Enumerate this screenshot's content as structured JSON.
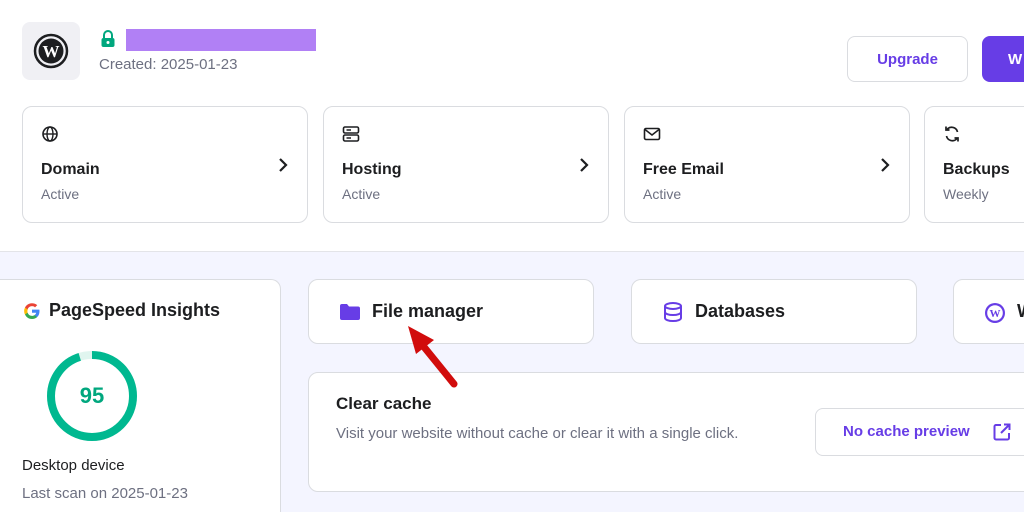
{
  "header": {
    "created": "Created: 2025-01-23",
    "upgrade_label": "Upgrade",
    "primary_label": "W"
  },
  "status_cards": [
    {
      "title": "Domain",
      "status": "Active",
      "icon": "globe-icon"
    },
    {
      "title": "Hosting",
      "status": "Active",
      "icon": "server-icon"
    },
    {
      "title": "Free Email",
      "status": "Active",
      "icon": "mail-icon"
    },
    {
      "title": "Backups",
      "status": "Weekly",
      "icon": "refresh-icon"
    }
  ],
  "pagespeed": {
    "title": "PageSpeed Insights",
    "score": "95",
    "score_fraction": 0.95,
    "device": "Desktop device",
    "last_scan": "Last scan on 2025-01-23"
  },
  "tools": [
    {
      "label": "File manager",
      "icon": "folder-icon"
    },
    {
      "label": "Databases",
      "icon": "database-icon"
    },
    {
      "label": "W",
      "icon": "wordpress-icon"
    }
  ],
  "cache": {
    "title": "Clear cache",
    "description": "Visit your website without cache or clear it with a single click.",
    "button_label": "No cache preview"
  },
  "colors": {
    "accent": "#673de6",
    "success": "#00a77e",
    "redaction": "#b180f5",
    "annotation_arrow": "#d10c0c"
  }
}
